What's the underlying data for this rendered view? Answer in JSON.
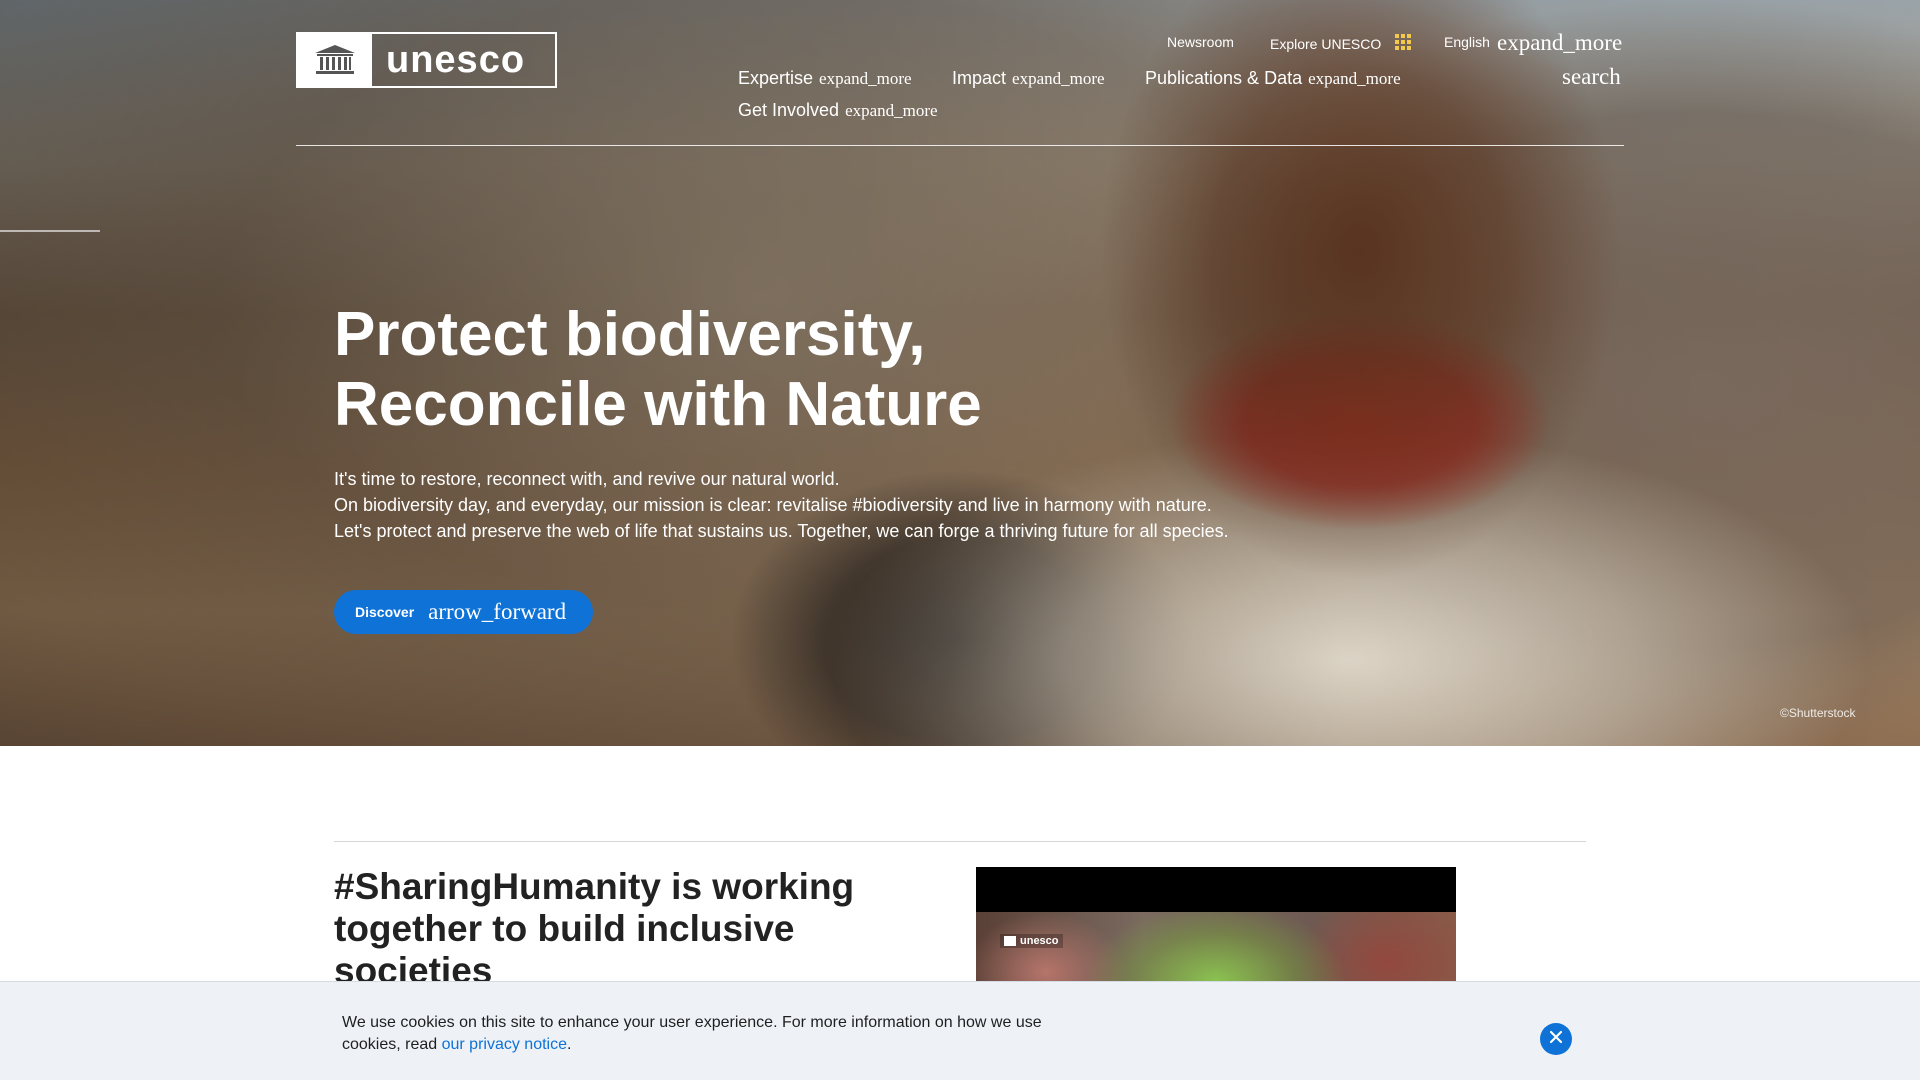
{
  "header": {
    "logo_text": "unesco",
    "utility": {
      "newsroom": "Newsroom",
      "explore": "Explore UNESCO",
      "language": "English"
    },
    "language_expand_glyph": "expand_more",
    "search_glyph": "search",
    "nav": [
      {
        "label": "Expertise",
        "glyph": "expand_more"
      },
      {
        "label": "Impact",
        "glyph": "expand_more"
      },
      {
        "label": "Publications & Data",
        "glyph": "expand_more"
      },
      {
        "label": "Get Involved",
        "glyph": "expand_more"
      }
    ]
  },
  "hero": {
    "title_lines": [
      "Protect biodiversity,",
      "Reconcile with Nature"
    ],
    "body_lines": [
      "It's time to restore, reconnect with, and revive our natural world.",
      "On biodiversity day, and everyday, our mission is clear: revitalise #biodiversity and live in harmony with nature.",
      "Let's protect and preserve the web of life that sustains us. Together, we can forge a thriving future for all species."
    ],
    "button_label": "Discover",
    "button_glyph": "arrow_forward",
    "credit": "©Shutterstock"
  },
  "section": {
    "title_lines": [
      "#SharingHumanity is working",
      "together to build inclusive",
      "societies"
    ],
    "video_logo_text": "unesco"
  },
  "cookie": {
    "text_before": "We use cookies on this site to enhance your user experience. For more information on how we use cookies, read ",
    "link_text": "our privacy notice",
    "text_after": "."
  },
  "icons": {
    "emblem": "unesco-temple-icon",
    "grid": "apps-grid-icon",
    "close": "close-icon"
  },
  "colors": {
    "accent": "#0e72d6",
    "cookie_bg": "#eef2f7"
  }
}
